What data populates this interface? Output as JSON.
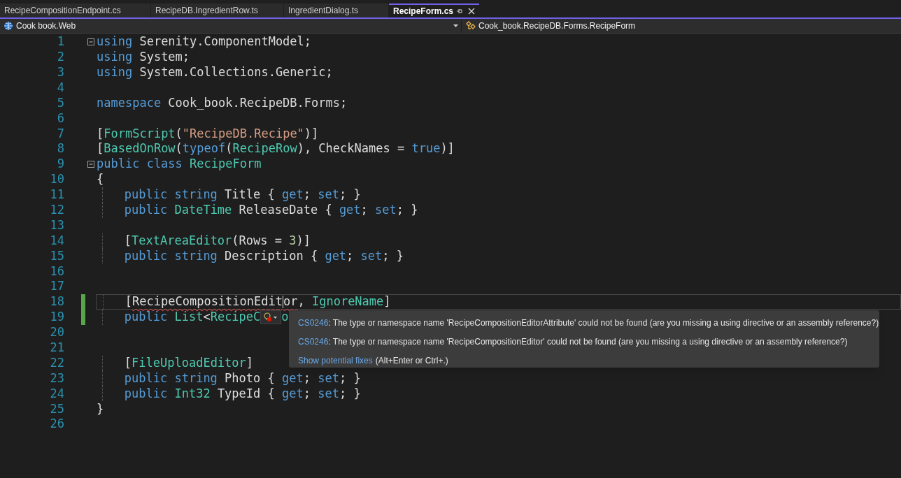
{
  "tabs": [
    {
      "label": "RecipeCompositionEndpoint.cs",
      "selected": false
    },
    {
      "label": "RecipeDB.IngredientRow.ts",
      "selected": false
    },
    {
      "label": "IngredientDialog.ts",
      "selected": false
    },
    {
      "label": "RecipeForm.cs",
      "selected": true
    }
  ],
  "navigation_bar": {
    "project": "Cook book.Web",
    "member": "Cook_book.RecipeDB.Forms.RecipeForm"
  },
  "code_lines": [
    {
      "number": "1",
      "fold": true,
      "tokens": [
        {
          "text": "using ",
          "kind": "keyword"
        },
        {
          "text": "Serenity.ComponentModel;",
          "kind": "plain"
        }
      ]
    },
    {
      "number": "2",
      "tokens": [
        {
          "text": "using ",
          "kind": "keyword"
        },
        {
          "text": "System;",
          "kind": "plain"
        }
      ]
    },
    {
      "number": "3",
      "tokens": [
        {
          "text": "using ",
          "kind": "keyword"
        },
        {
          "text": "System.Collections.Generic;",
          "kind": "plain"
        }
      ]
    },
    {
      "number": "4"
    },
    {
      "number": "5",
      "tokens": [
        {
          "text": "namespace ",
          "kind": "keyword"
        },
        {
          "text": "Cook_book.RecipeDB.Forms;",
          "kind": "plain"
        }
      ]
    },
    {
      "number": "6"
    },
    {
      "number": "7",
      "tokens": [
        {
          "text": "[",
          "kind": "plain"
        },
        {
          "text": "FormScript",
          "kind": "type"
        },
        {
          "text": "(",
          "kind": "plain"
        },
        {
          "text": "\"RecipeDB.Recipe\"",
          "kind": "string"
        },
        {
          "text": ")]",
          "kind": "plain"
        }
      ]
    },
    {
      "number": "8",
      "tokens": [
        {
          "text": "[",
          "kind": "plain"
        },
        {
          "text": "BasedOnRow",
          "kind": "type"
        },
        {
          "text": "(",
          "kind": "plain"
        },
        {
          "text": "typeof",
          "kind": "keyword"
        },
        {
          "text": "(",
          "kind": "plain"
        },
        {
          "text": "RecipeRow",
          "kind": "type"
        },
        {
          "text": "), CheckNames = ",
          "kind": "plain"
        },
        {
          "text": "true",
          "kind": "keyword"
        },
        {
          "text": ")]",
          "kind": "plain"
        }
      ]
    },
    {
      "number": "9",
      "fold": true,
      "tokens": [
        {
          "text": "public class ",
          "kind": "keyword"
        },
        {
          "text": "RecipeForm",
          "kind": "type"
        }
      ]
    },
    {
      "number": "10",
      "tokens": [
        {
          "text": "{",
          "kind": "plain"
        }
      ]
    },
    {
      "number": "11",
      "indented": true,
      "tokens": [
        {
          "text": "public string ",
          "kind": "keyword"
        },
        {
          "text": "Title { ",
          "kind": "plain"
        },
        {
          "text": "get",
          "kind": "keyword"
        },
        {
          "text": "; ",
          "kind": "plain"
        },
        {
          "text": "set",
          "kind": "keyword"
        },
        {
          "text": "; }",
          "kind": "plain"
        }
      ]
    },
    {
      "number": "12",
      "indented": true,
      "tokens": [
        {
          "text": "public ",
          "kind": "keyword"
        },
        {
          "text": "DateTime",
          "kind": "type"
        },
        {
          "text": " ReleaseDate { ",
          "kind": "plain"
        },
        {
          "text": "get",
          "kind": "keyword"
        },
        {
          "text": "; ",
          "kind": "plain"
        },
        {
          "text": "set",
          "kind": "keyword"
        },
        {
          "text": "; }",
          "kind": "plain"
        }
      ]
    },
    {
      "number": "13"
    },
    {
      "number": "14",
      "indented": true,
      "tokens": [
        {
          "text": "[",
          "kind": "plain"
        },
        {
          "text": "TextAreaEditor",
          "kind": "type"
        },
        {
          "text": "(Rows = ",
          "kind": "plain"
        },
        {
          "text": "3",
          "kind": "number"
        },
        {
          "text": ")]",
          "kind": "plain"
        }
      ]
    },
    {
      "number": "15",
      "indented": true,
      "tokens": [
        {
          "text": "public string ",
          "kind": "keyword"
        },
        {
          "text": "Description { ",
          "kind": "plain"
        },
        {
          "text": "get",
          "kind": "keyword"
        },
        {
          "text": "; ",
          "kind": "plain"
        },
        {
          "text": "set",
          "kind": "keyword"
        },
        {
          "text": "; }",
          "kind": "plain"
        }
      ]
    },
    {
      "number": "16"
    },
    {
      "number": "17"
    },
    {
      "number": "18",
      "changed": true,
      "current": true,
      "indented": true,
      "tokens": [
        {
          "text": "[",
          "kind": "plain"
        },
        {
          "text": "RecipeCompositionEdit",
          "kind": "plain",
          "error": true,
          "caret": true
        },
        {
          "text": "or",
          "kind": "plain",
          "error": true
        },
        {
          "text": ", ",
          "kind": "plain"
        },
        {
          "text": "IgnoreName",
          "kind": "type"
        },
        {
          "text": "]",
          "kind": "plain"
        }
      ]
    },
    {
      "number": "19",
      "changed": true,
      "indented": true,
      "tokens": [
        {
          "text": "public ",
          "kind": "keyword"
        },
        {
          "text": "List",
          "kind": "type"
        },
        {
          "text": "<",
          "kind": "plain"
        },
        {
          "text": "RecipeC",
          "kind": "type"
        },
        {
          "kind": "lightbulb"
        },
        {
          "text": "o",
          "kind": "type"
        }
      ]
    },
    {
      "number": "20"
    },
    {
      "number": "21"
    },
    {
      "number": "22",
      "indented": true,
      "tokens": [
        {
          "text": "[",
          "kind": "plain"
        },
        {
          "text": "FileUploadEditor",
          "kind": "type"
        },
        {
          "text": "]",
          "kind": "plain"
        }
      ]
    },
    {
      "number": "23",
      "indented": true,
      "tokens": [
        {
          "text": "public string ",
          "kind": "keyword"
        },
        {
          "text": "Photo { ",
          "kind": "plain"
        },
        {
          "text": "get",
          "kind": "keyword"
        },
        {
          "text": "; ",
          "kind": "plain"
        },
        {
          "text": "set",
          "kind": "keyword"
        },
        {
          "text": "; }",
          "kind": "plain"
        }
      ]
    },
    {
      "number": "24",
      "indented": true,
      "tokens": [
        {
          "text": "public ",
          "kind": "keyword"
        },
        {
          "text": "Int32",
          "kind": "type"
        },
        {
          "text": " TypeId { ",
          "kind": "plain"
        },
        {
          "text": "get",
          "kind": "keyword"
        },
        {
          "text": "; ",
          "kind": "plain"
        },
        {
          "text": "set",
          "kind": "keyword"
        },
        {
          "text": "; }",
          "kind": "plain"
        }
      ]
    },
    {
      "number": "25",
      "tokens": [
        {
          "text": "}",
          "kind": "plain"
        }
      ]
    },
    {
      "number": "26"
    }
  ],
  "error_tooltip": {
    "errors": [
      {
        "code": "CS0246",
        "message": ": The type or namespace name 'RecipeCompositionEditorAttribute' could not be found (are you missing a using directive or an assembly reference?)"
      },
      {
        "code": "CS0246",
        "message": ": The type or namespace name 'RecipeCompositionEditor' could not be found (are you missing a using directive or an assembly reference?)"
      }
    ],
    "fixes_link": "Show potential fixes",
    "fixes_hint": "(Alt+Enter or Ctrl+.)"
  }
}
